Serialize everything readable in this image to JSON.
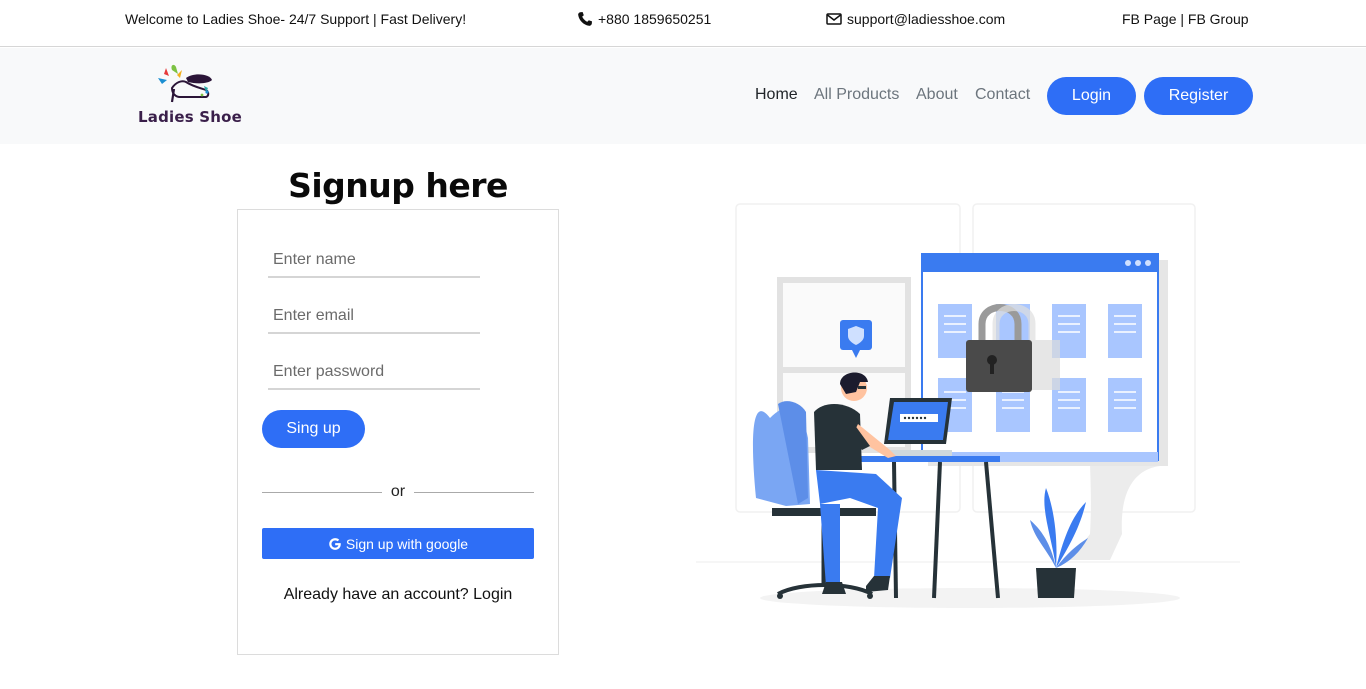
{
  "topbar": {
    "welcome": "Welcome to Ladies Shoe- 24/7 Support | Fast Delivery!",
    "phone": "+880 1859650251",
    "email": "support@ladiesshoe.com",
    "social": "FB Page | FB Group"
  },
  "brand": {
    "name": "Ladies Shoe"
  },
  "nav": {
    "items": [
      {
        "label": "Home",
        "active": true
      },
      {
        "label": "All Products",
        "active": false
      },
      {
        "label": "About",
        "active": false
      },
      {
        "label": "Contact",
        "active": false
      }
    ],
    "login_label": "Login",
    "register_label": "Register"
  },
  "signup": {
    "title": "Signup here",
    "name_placeholder": "Enter name",
    "email_placeholder": "Enter email",
    "password_placeholder": "Enter password",
    "submit_label": "Sing up",
    "or_label": "or",
    "google_label": "Sign up with google",
    "login_prompt": "Already have an account? Login"
  },
  "colors": {
    "primary": "#2e6ef6",
    "navbar_bg": "#f8f9fa",
    "illustration_blue": "#3a7bf0"
  }
}
